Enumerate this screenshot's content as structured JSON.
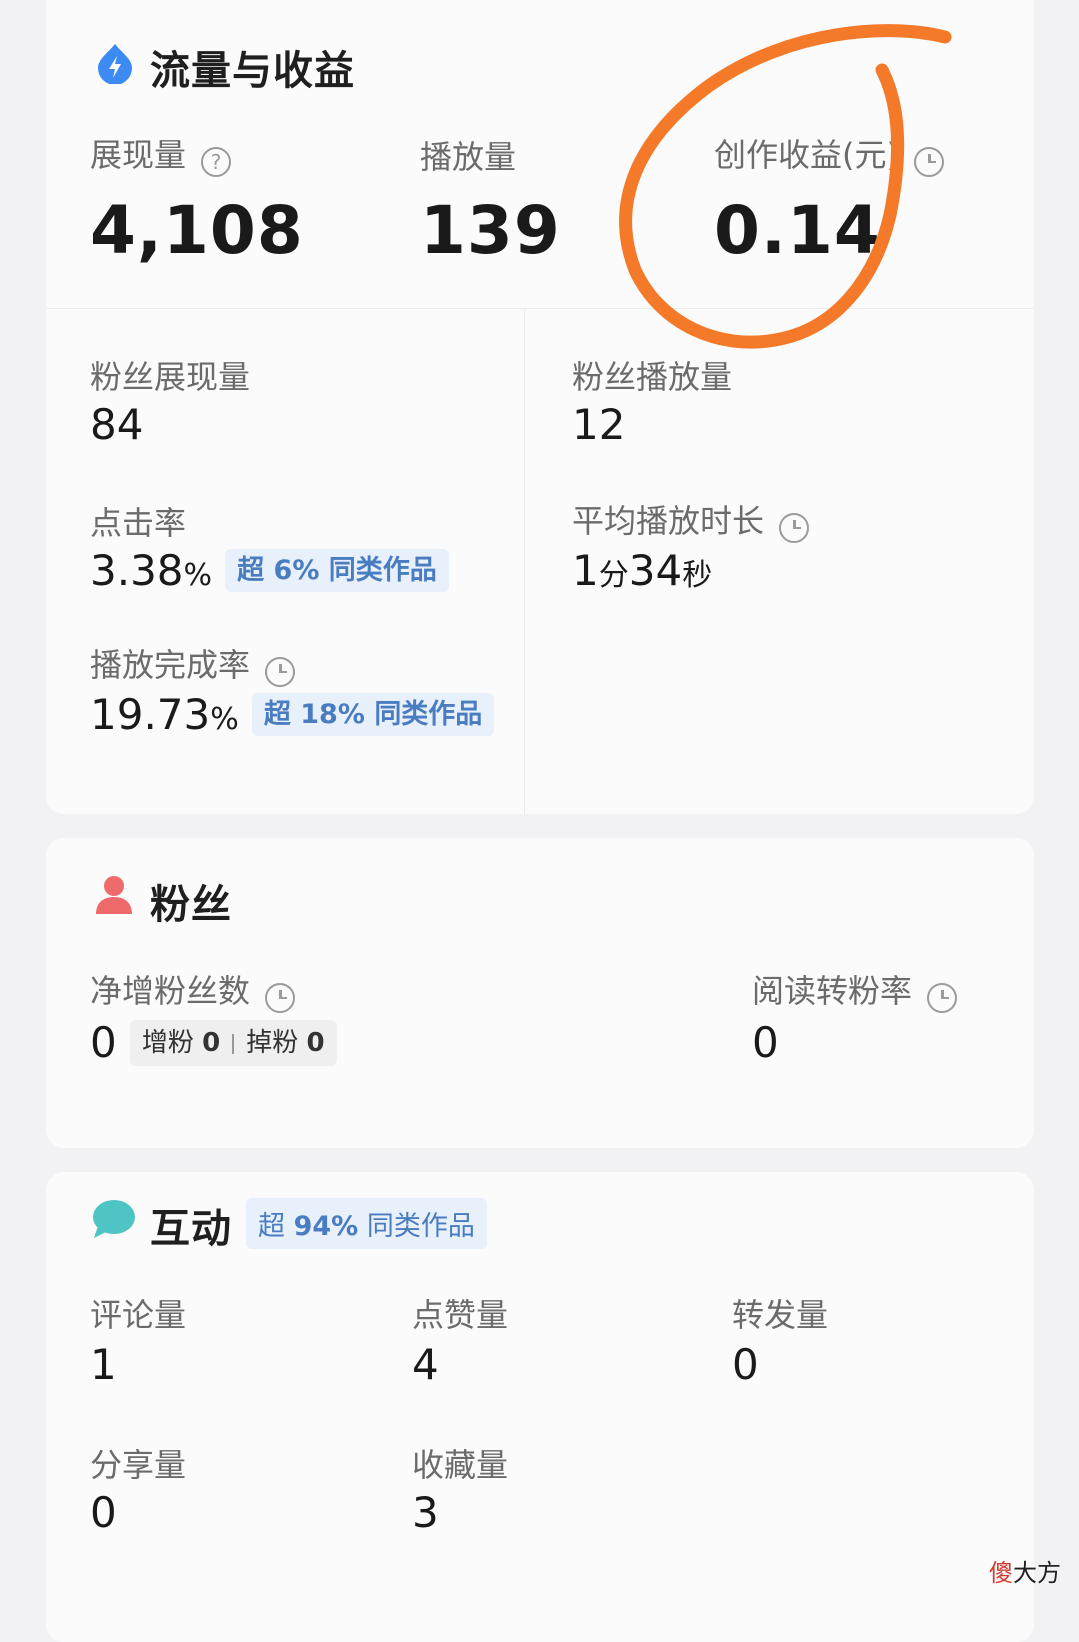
{
  "traffic": {
    "title": "流量与收益",
    "impressions": {
      "label": "展现量",
      "value": "4,108"
    },
    "plays": {
      "label": "播放量",
      "value": "139"
    },
    "earnings": {
      "label": "创作收益(元)",
      "value": "0.14"
    },
    "fan_impressions": {
      "label": "粉丝展现量",
      "value": "84"
    },
    "fan_plays": {
      "label": "粉丝播放量",
      "value": "12"
    },
    "ctr": {
      "label": "点击率",
      "value": "3.38",
      "unit": "%",
      "badge_prefix": "超",
      "badge_pct": "6%",
      "badge_suffix": "同类作品"
    },
    "avg_duration": {
      "label": "平均播放时长",
      "min_value": "1",
      "min_unit": "分",
      "sec_value": "34",
      "sec_unit": "秒"
    },
    "completion": {
      "label": "播放完成率",
      "value": "19.73",
      "unit": "%",
      "badge_prefix": "超",
      "badge_pct": "18%",
      "badge_suffix": "同类作品"
    }
  },
  "fans": {
    "title": "粉丝",
    "net_gain": {
      "label": "净增粉丝数",
      "value": "0",
      "gain_label": "增粉",
      "gain_value": "0",
      "loss_label": "掉粉",
      "loss_value": "0"
    },
    "conversion": {
      "label": "阅读转粉率",
      "value": "0"
    }
  },
  "interaction": {
    "title": "互动",
    "badge_prefix": "超",
    "badge_pct": "94%",
    "badge_suffix": "同类作品",
    "comments": {
      "label": "评论量",
      "value": "1"
    },
    "likes": {
      "label": "点赞量",
      "value": "4"
    },
    "reposts": {
      "label": "转发量",
      "value": "0"
    },
    "shares": {
      "label": "分享量",
      "value": "0"
    },
    "favorites": {
      "label": "收藏量",
      "value": "3"
    }
  },
  "watermark": {
    "first": "傻",
    "rest": "大方"
  },
  "colors": {
    "accent_blue": "#3d8bf2",
    "fans_red": "#ef6b6b",
    "interaction_teal": "#4fc4c4",
    "annotation_orange": "#f47a2a"
  },
  "icons": [
    "lightning-drop-icon",
    "person-icon",
    "chat-bubble-icon",
    "help-circle-icon",
    "clock-icon"
  ]
}
